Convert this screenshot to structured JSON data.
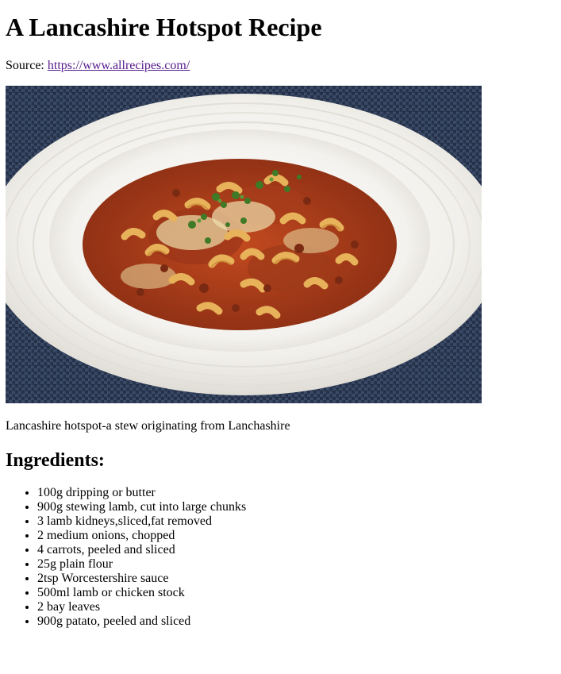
{
  "title": "A Lancashire Hotspot Recipe",
  "source": {
    "label": "Source: ",
    "link_text": "https://www.allrecipes.com/"
  },
  "photo": {
    "subject": "bowl of pasta stew with minced meat, cheese and parsley on a blue woven placemat"
  },
  "caption": "Lancashire hotspot-a stew originating from Lanchashire",
  "ingredients_heading": "Ingredients:",
  "ingredients": [
    "100g dripping or butter",
    "900g stewing lamb, cut into large chunks",
    "3 lamb kidneys,sliced,fat removed",
    "2 medium onions, chopped",
    "4 carrots, peeled and sliced",
    "25g plain flour",
    "2tsp Worcestershire sauce",
    "500ml lamb or chicken stock",
    "2 bay leaves",
    "900g patato, peeled and sliced"
  ],
  "colors": {
    "link": "#551a8b",
    "placemat": "#2b3850",
    "plate": "#f3f1ec",
    "sauce": "#b4421c",
    "pasta": "#e7b25a",
    "parsley": "#3f7a26"
  }
}
